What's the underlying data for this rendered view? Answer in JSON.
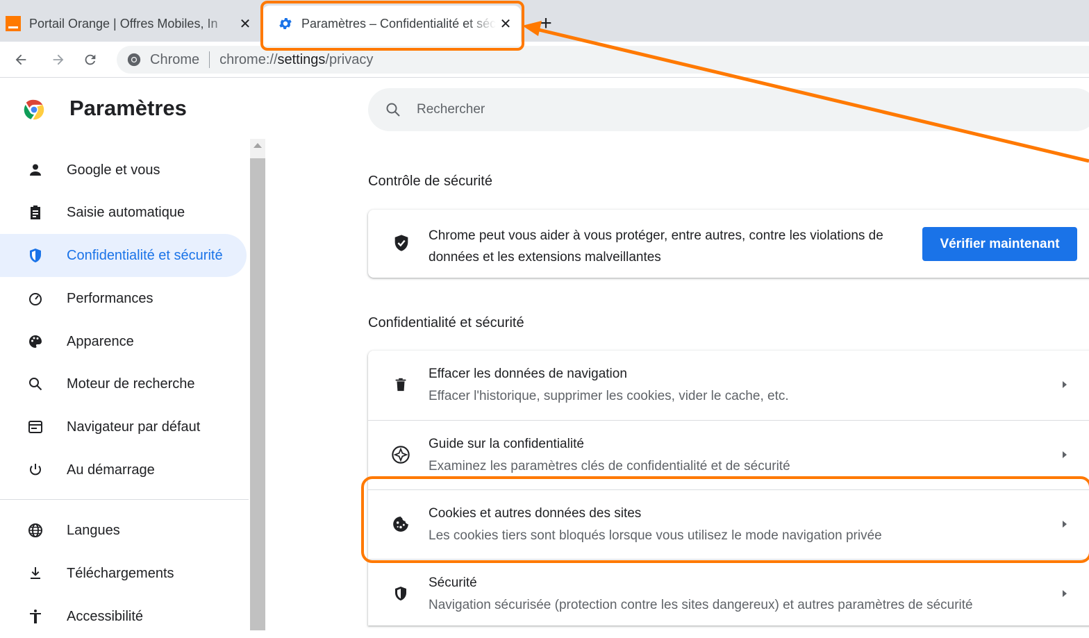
{
  "tabs": [
    {
      "title": "Portail Orange | Offres Mobiles, In",
      "close": "✕",
      "favicon": "orange-logo-icon"
    },
    {
      "title": "Paramètres – Confidentialité et sécurité",
      "close": "✕",
      "favicon": "gear-icon"
    }
  ],
  "new_tab": "+",
  "toolbar": {
    "omnibox_label": "Chrome",
    "url_prefix": "chrome://",
    "url_bold": "settings",
    "url_suffix": "/privacy"
  },
  "header": {
    "title": "Paramètres",
    "search_placeholder": "Rechercher"
  },
  "sidebar": {
    "items": [
      {
        "label": "Google et vous",
        "icon": "person-icon"
      },
      {
        "label": "Saisie automatique",
        "icon": "clipboard-icon"
      },
      {
        "label": "Confidentialité et sécurité",
        "icon": "shield-icon",
        "active": true
      },
      {
        "label": "Performances",
        "icon": "speedometer-icon"
      },
      {
        "label": "Apparence",
        "icon": "palette-icon"
      },
      {
        "label": "Moteur de recherche",
        "icon": "search-icon"
      },
      {
        "label": "Navigateur par défaut",
        "icon": "browser-icon"
      },
      {
        "label": "Au démarrage",
        "icon": "power-icon"
      },
      {
        "label": "Langues",
        "icon": "globe-icon"
      },
      {
        "label": "Téléchargements",
        "icon": "download-icon"
      },
      {
        "label": "Accessibilité",
        "icon": "accessibility-icon"
      }
    ]
  },
  "safety_check": {
    "section_title": "Contrôle de sécurité",
    "text_line1": "Chrome peut vous aider à vous protéger, entre autres, contre les violations de",
    "text_line2": "données et les extensions malveillantes",
    "button": "Vérifier maintenant"
  },
  "privacy": {
    "section_title": "Confidentialité et sécurité",
    "rows": [
      {
        "title": "Effacer les données de navigation",
        "subtitle": "Effacer l'historique, supprimer les cookies, vider le cache, etc.",
        "icon": "trash-icon"
      },
      {
        "title": "Guide sur la confidentialité",
        "subtitle": "Examinez les paramètres clés de confidentialité et de sécurité",
        "icon": "compass-icon"
      },
      {
        "title": "Cookies et autres données des sites",
        "subtitle": "Les cookies tiers sont bloqués lorsque vous utilisez le mode navigation privée",
        "icon": "cookie-icon"
      },
      {
        "title": "Sécurité",
        "subtitle": "Navigation sécurisée (protection contre les sites dangereux) et autres paramètres de sécurité",
        "icon": "security-shield-icon"
      }
    ]
  },
  "colors": {
    "accent": "#1a73e8",
    "annotation": "#ff7900",
    "active_bg": "#e8f0fe"
  }
}
